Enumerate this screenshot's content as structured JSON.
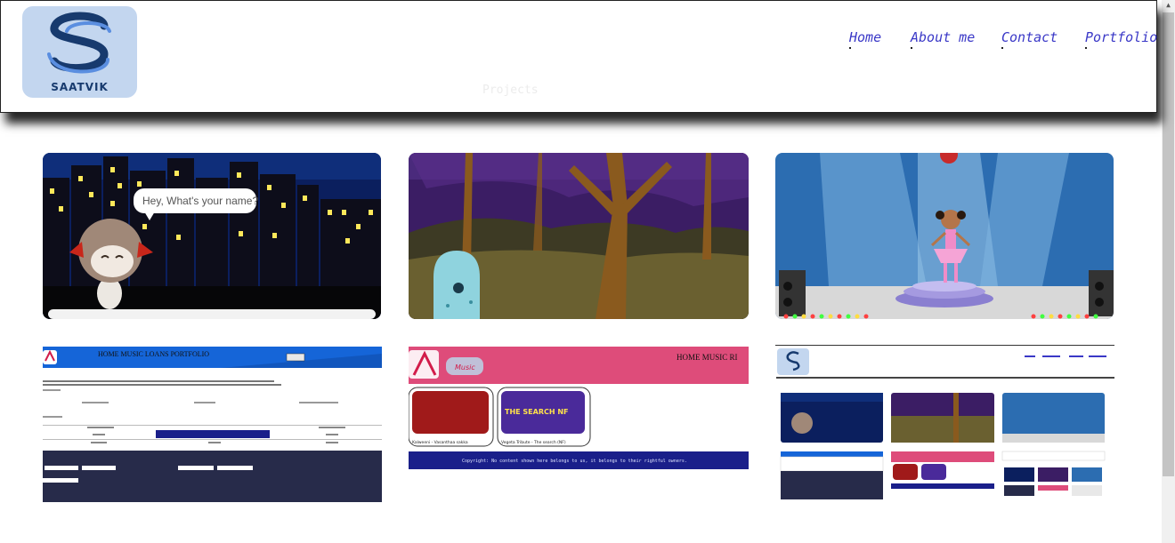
{
  "brand": {
    "name": "SAATVIK"
  },
  "nav": {
    "items": [
      {
        "label": "Home"
      },
      {
        "label": "About me"
      },
      {
        "label": "Contact"
      },
      {
        "label": "Portfolio"
      }
    ]
  },
  "section": {
    "title": "Projects"
  },
  "projects": [
    {
      "speech": "Hey, What's your name?"
    },
    {},
    {},
    {
      "nav": "HOME  MUSIC  LOANS  PORTFOLIO"
    },
    {
      "nav": "HOME   MUSIC   RI",
      "tracks": [
        "Kalweeni - Vasanthaa sakka",
        "Vegeta Tribute - The search (NF)"
      ],
      "badge": "Music",
      "album_text": "THE SEARCH NF",
      "footer": "Copyright: No content shown here belongs to us, it belongs to their rightful owners."
    },
    {}
  ],
  "colors": {
    "accent": "#3a38c7",
    "brand_bg": "#c3d6ef"
  }
}
